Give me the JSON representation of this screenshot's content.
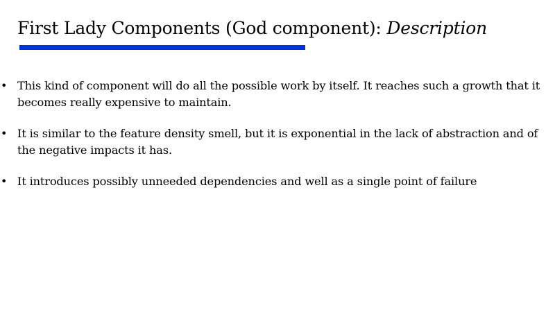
{
  "title": {
    "main": "First Lady Components (God component):",
    "italic": "Description"
  },
  "colors": {
    "rule": "#0033dd"
  },
  "bullets": [
    {
      "marker": "•",
      "text": "This kind of component will do all the possible work by itself. It reaches such a growth that it becomes really expensive to maintain."
    },
    {
      "marker": "•",
      "text": "It is similar to the feature density smell, but it is exponential in the lack of abstraction and of the negative impacts it has."
    },
    {
      "marker": "•",
      "text": "It introduces possibly unneeded dependencies and well as a single point of failure"
    }
  ]
}
